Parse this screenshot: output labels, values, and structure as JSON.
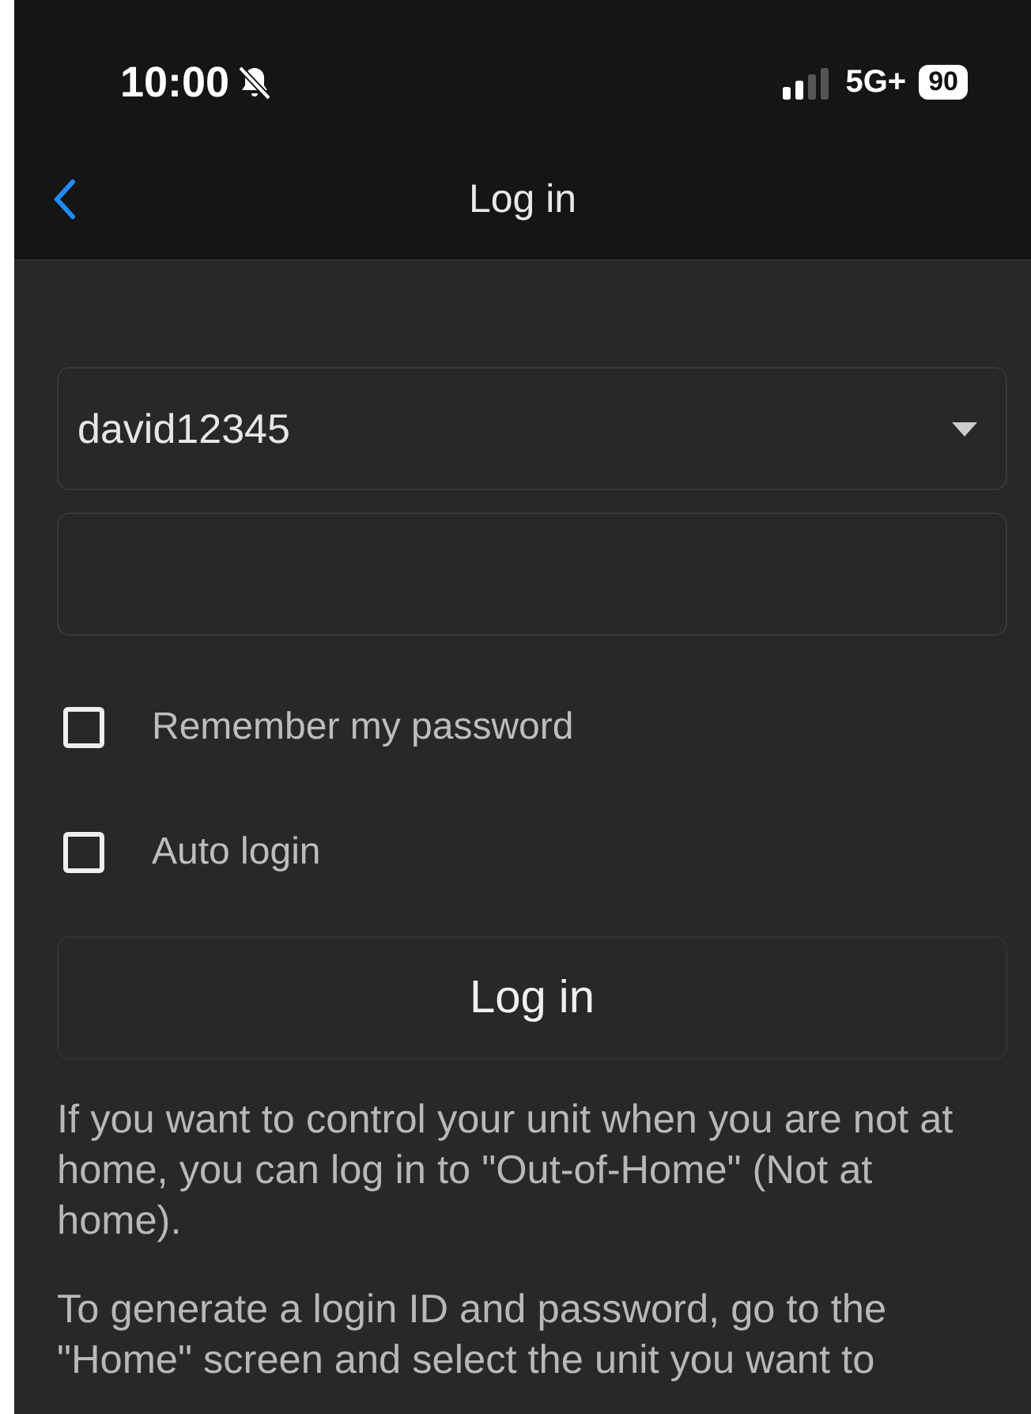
{
  "status_bar": {
    "time": "10:00",
    "silent": true,
    "network": "5G+",
    "battery": "90"
  },
  "nav": {
    "title": "Log in"
  },
  "form": {
    "user_id": {
      "value": "david12345"
    },
    "password_field": true,
    "options": [
      {
        "label": "Remember my password",
        "checked": false
      },
      {
        "label": "Auto login",
        "checked": false
      }
    ],
    "submit": "Log in"
  },
  "info": [
    "If you want to control your unit when you are not at home, you can log in to \"Out-of-Home\" (Not at home).",
    "To generate a login ID and password, go to the \"Home\" screen and select the unit you want to"
  ]
}
